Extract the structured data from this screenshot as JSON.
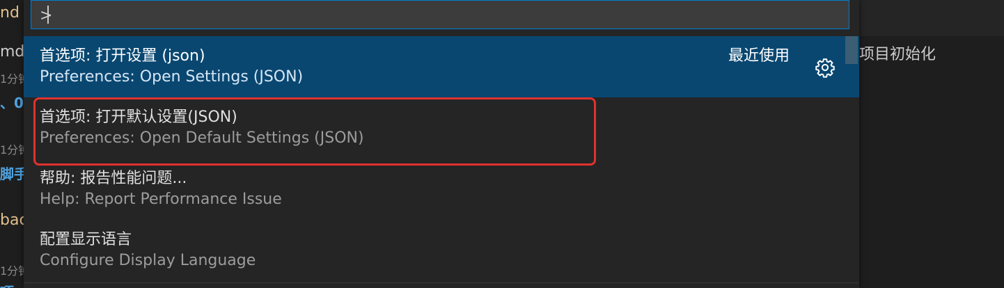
{
  "background": {
    "left_fragments": [
      "nd",
      "md",
      "1分钟",
      "、0",
      "1分钟",
      "脚手",
      "bac",
      "1分钟",
      "项"
    ],
    "right_text": "项目初始化"
  },
  "quick_pick": {
    "input_value": ">",
    "recently_used_label": "最近使用",
    "items": [
      {
        "label": "首选项: 打开设置 (json)",
        "detail": "Preferences: Open Settings (JSON)",
        "selected": true
      },
      {
        "label": "首选项: 打开默认设置(JSON)",
        "detail": "Preferences: Open Default Settings (JSON)",
        "selected": false,
        "annotated": true
      },
      {
        "label": "帮助: 报告性能问题...",
        "detail": "Help: Report Performance Issue",
        "selected": false
      },
      {
        "label": "配置显示语言",
        "detail": "Configure Display Language",
        "selected": false
      }
    ]
  },
  "icons": {
    "gear": "gear-icon"
  },
  "colors": {
    "selection_bg": "#094771",
    "input_border": "#007fd4",
    "annotation": "#e0322d",
    "widget_bg": "#252526"
  }
}
